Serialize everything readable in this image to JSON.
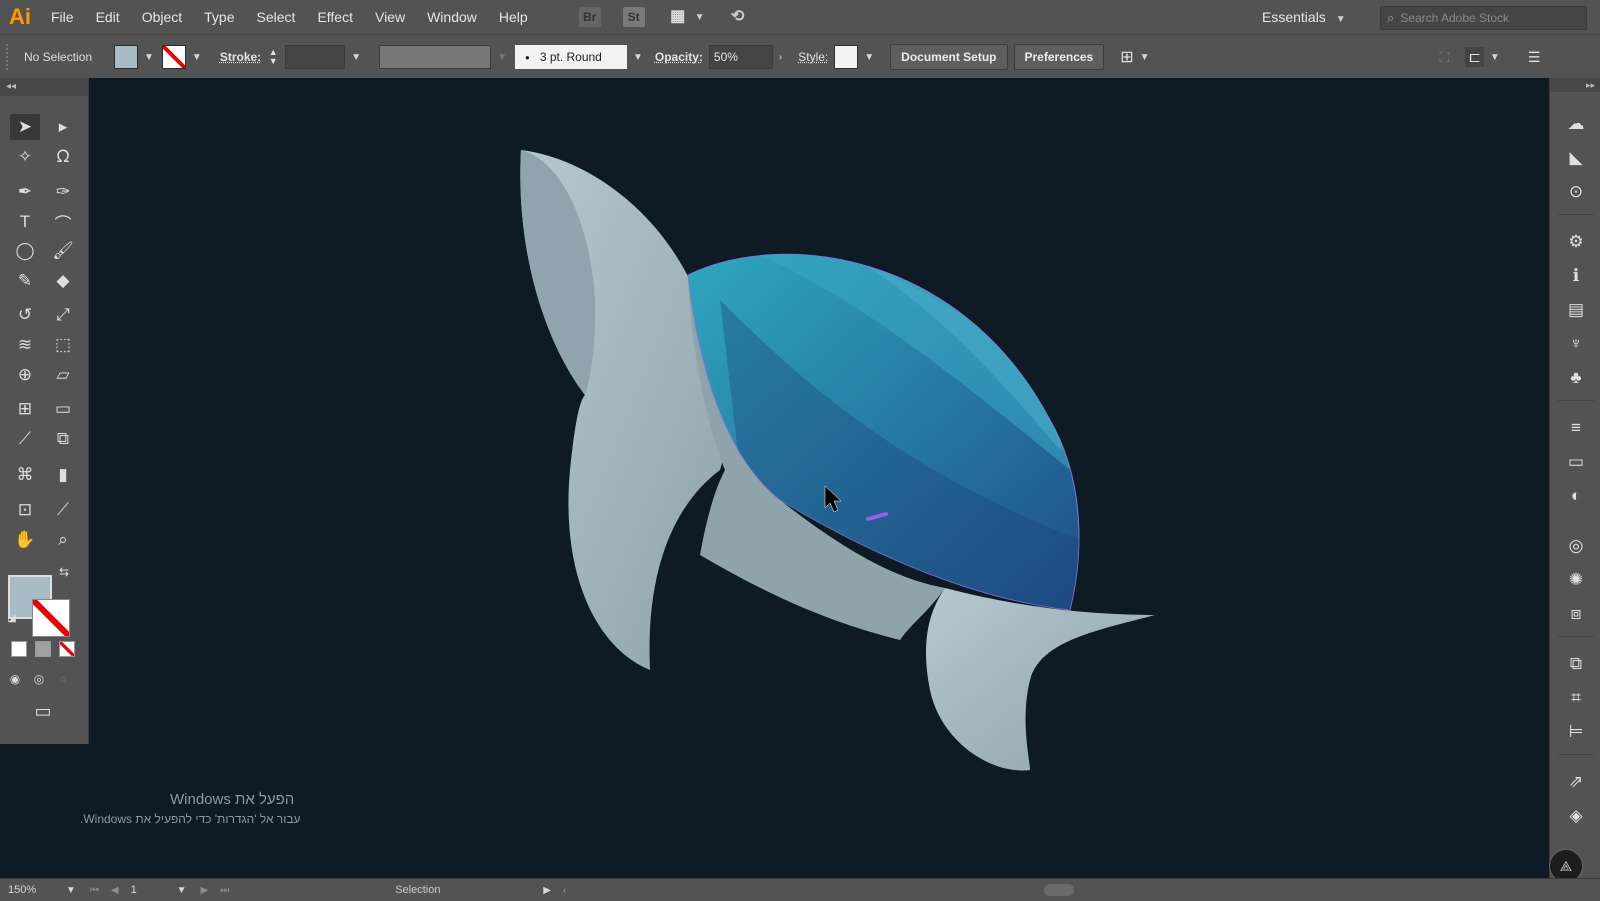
{
  "app": {
    "logo": "Ai"
  },
  "menu": [
    "File",
    "Edit",
    "Object",
    "Type",
    "Select",
    "Effect",
    "View",
    "Window",
    "Help"
  ],
  "menubar_icons": [
    {
      "name": "bridge-icon",
      "glyph": "Br"
    },
    {
      "name": "stock-icon",
      "glyph": "St"
    },
    {
      "name": "arrange-documents-icon",
      "glyph": "▦"
    },
    {
      "name": "gpu-performance-icon",
      "glyph": "⟲"
    }
  ],
  "workspace": {
    "label": "Essentials"
  },
  "search": {
    "placeholder": "Search Adobe Stock"
  },
  "control": {
    "selection": "No Selection",
    "fill_color": "#a7bcc4",
    "stroke_label": "Stroke:",
    "brush": "3 pt. Round",
    "opacity_label": "Opacity:",
    "opacity_value": "50%",
    "style_label": "Style:",
    "document_setup": "Document Setup",
    "preferences": "Preferences"
  },
  "status": {
    "zoom": "150%",
    "artboard": "1",
    "tool": "Selection"
  },
  "watermark": {
    "title": "הפעל את Windows",
    "subtitle": "עבור אל 'הגדרות' כדי להפעיל את Windows."
  },
  "colors": {
    "canvas": "#0f1b24",
    "turtle_body": "#9fb3bb",
    "shell_light": "#2fa7bf",
    "shell_dark": "#1f4e86",
    "ui_panel": "#535353"
  }
}
